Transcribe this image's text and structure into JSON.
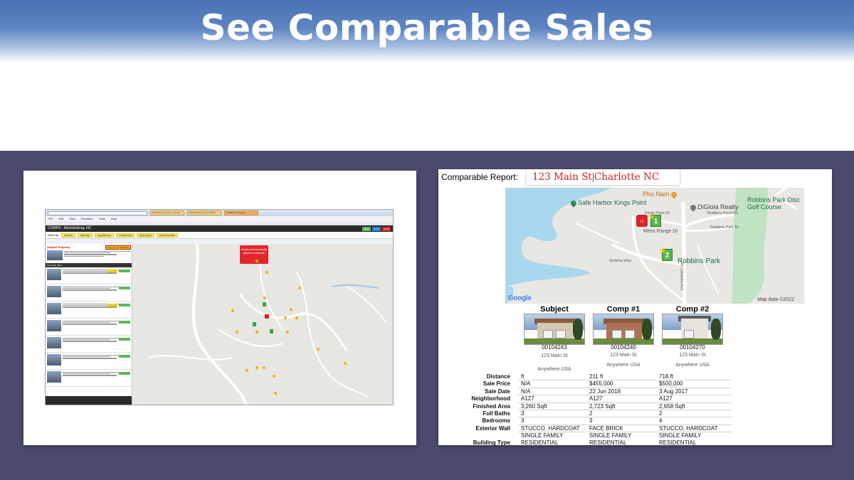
{
  "slide": {
    "title": "See Comparable Sales",
    "colors": {
      "header": "#4a72b3",
      "band": "#4b4a6e",
      "accent_red": "#d21f1f"
    }
  },
  "left_screenshot": {
    "tabs": [
      "Mecklenburg County - Proper...",
      "Mecklenburg County (TEST...",
      "COMPS in Services"
    ],
    "menu": [
      "File",
      "Edit",
      "View",
      "Favorites",
      "Tools",
      "Help"
    ],
    "app_title": "COMPS - Mecklenburg, NC",
    "app_buttons": [
      {
        "label": "Help",
        "color": "#5cb85c"
      },
      {
        "label": "Print",
        "color": "#2a7bd3"
      },
      {
        "label": "Close",
        "color": "#d9261c"
      }
    ],
    "refine_label": "Refine By:",
    "filters": [
      "Distance",
      "Sale Date",
      "Neighborhood",
      "Finished Area",
      "Story Height",
      "Actual Year Built"
    ],
    "subject_label": "Subject Property",
    "subject_button": "Save My Comparables",
    "callout": "Creates pdf automatically attaches to Media tab",
    "sorted_header": "Sorted By Sales",
    "icons": [
      "search-icon",
      "home-icon",
      "star-icon"
    ]
  },
  "report": {
    "label": "Comparable Report:",
    "address": "123 Main St",
    "city": "Charlotte NC",
    "map": {
      "pois": [
        "Pho Nam",
        "Safe Harbor Kings Point",
        "DiGioia Realty",
        "Robbins Park Disc Golf Course",
        "Robbins Park"
      ],
      "streets": [
        "Kings Point Dr",
        "Mess Range Dr",
        "Robbins Pond Rd",
        "Robbins Park Dr",
        "Sedona Way",
        "W Catawba Ave"
      ],
      "pin_labels": [
        "1",
        "2"
      ],
      "attribution": "Map data ©2022",
      "logo": "Google"
    },
    "columns": [
      {
        "header": "Subject",
        "id": "00104243",
        "addr1": "123 Main St",
        "addr2": "Anywhere USA"
      },
      {
        "header": "Comp #1",
        "id": "00104240",
        "addr1": "123 Main St",
        "addr2": "Anywhere USA"
      },
      {
        "header": "Comp #2",
        "id": "00104270",
        "addr1": "123 Main St",
        "addr2": "Anywhere USA"
      }
    ],
    "rows": [
      {
        "label": "Distance",
        "values": [
          "ft",
          "211 ft",
          "718 ft"
        ]
      },
      {
        "label": "Sale Price",
        "values": [
          "N/A",
          "$455,000",
          "$500,000"
        ]
      },
      {
        "label": "Sale Date",
        "values": [
          "N/A",
          "22 Jun 2018",
          "3 Aug 2017"
        ]
      },
      {
        "label": "Neighborhood",
        "values": [
          "A127",
          "A127",
          "A127"
        ]
      },
      {
        "label": "Finished Area",
        "values": [
          "3,260 Sqft",
          "2,723 Sqft",
          "2,658 Sqft"
        ]
      },
      {
        "label": "Full Baths",
        "values": [
          "3",
          "2",
          "2"
        ]
      },
      {
        "label": "Bedrooms",
        "values": [
          "3",
          "3",
          "4"
        ]
      },
      {
        "label": "Exterior Wall",
        "values": [
          "STUCCO, HARDCOAT",
          "FACE BRICK",
          "STUCCO, HARDCOAT"
        ]
      },
      {
        "label": "",
        "values": [
          "SINGLE FAMILY",
          "SINGLE FAMILY",
          "SINGLE FAMILY"
        ]
      },
      {
        "label": "Building Type",
        "values": [
          "RESIDENTIAL",
          "RESIDENTIAL",
          "RESIDENTIAL"
        ]
      }
    ]
  }
}
